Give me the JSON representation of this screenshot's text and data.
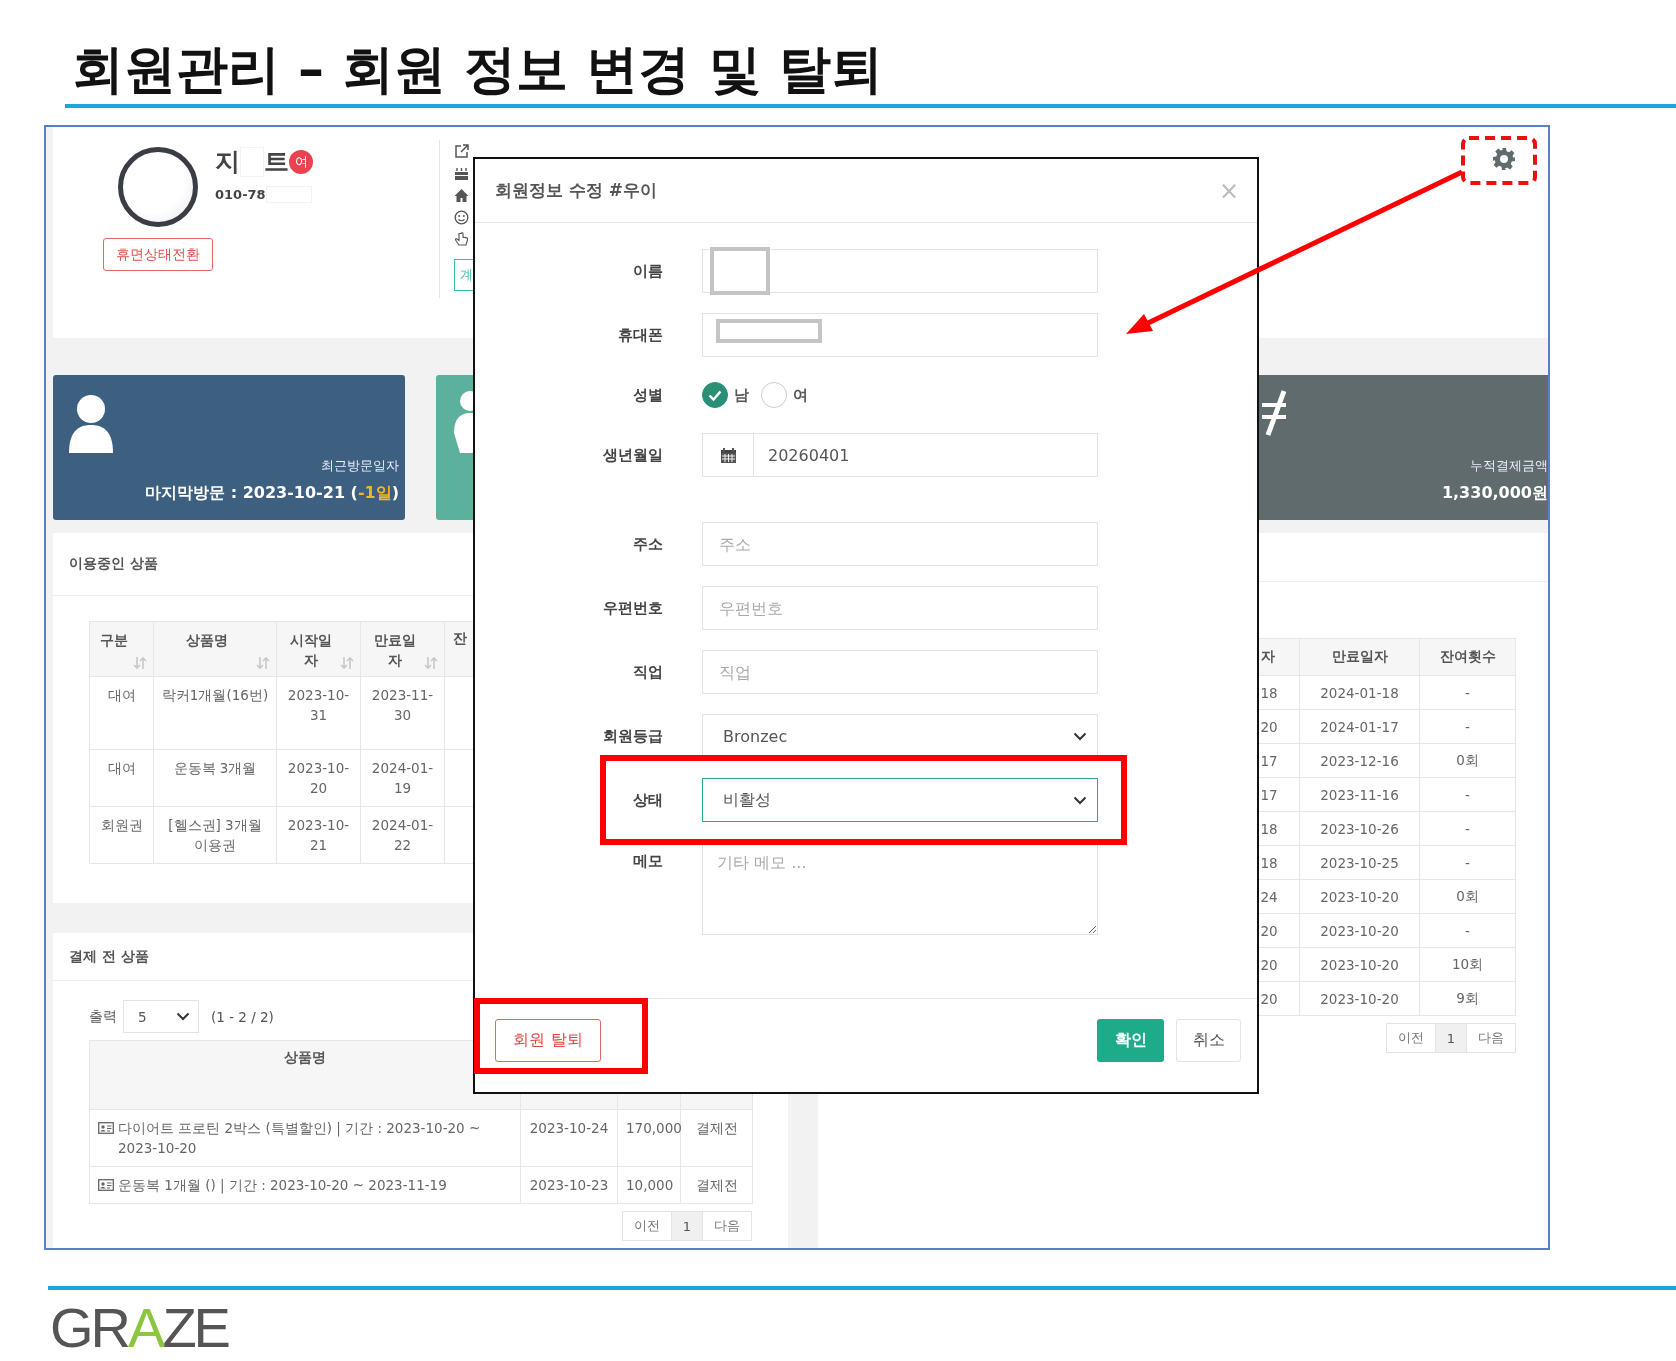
{
  "slide": {
    "title": "회원관리 – 회원 정보 변경 및 탈퇴",
    "logo": "GRAZE"
  },
  "profile": {
    "name_start": "지",
    "name_end": "트",
    "gender_badge": "여",
    "phone": "010-78",
    "dormant_button": "휴면상태전환",
    "side_button": "계"
  },
  "stats": [
    {
      "kind": "visit",
      "label": "최근방문일자",
      "prefix": "마지막방문 : 2023-10-21 (",
      "highlight": "-1일",
      "suffix": ")"
    },
    {
      "kind": "member"
    },
    {
      "kind": "payment",
      "label": "누적결제금액",
      "value": "1,330,000원"
    }
  ],
  "products_in_use": {
    "title": "이용중인 상품",
    "columns": [
      "구분",
      "상품명",
      "시작일자",
      "만료일자",
      "잔"
    ],
    "rows": [
      [
        "대여",
        "락커1개월(16번)",
        "2023-10-31",
        "2023-11-30"
      ],
      [
        "대여",
        "운동복 3개월",
        "2023-10-20",
        "2024-01-19"
      ],
      [
        "회원권",
        "[헬스권] 3개월 이용권",
        "2023-10-21",
        "2024-01-22"
      ]
    ]
  },
  "pending_products": {
    "title": "결제 전 상품",
    "page_size_label": "출력",
    "page_size": "5",
    "range": "(1 - 2 / 2)",
    "columns": [
      "상품명"
    ],
    "rows": [
      [
        "다이어트 프로틴 2박스 (특별할인) | 기간 : 2023-10-20 ~ 2023-10-20",
        "2023-10-24",
        "170,000",
        "결제전"
      ],
      [
        "운동복 1개월 () | 기간 : 2023-10-20 ~ 2023-11-19",
        "2023-10-23",
        "10,000",
        "결제전"
      ]
    ],
    "pagination": [
      {
        "label": "이전",
        "selected": false
      },
      {
        "label": "1",
        "selected": true
      },
      {
        "label": "다음",
        "selected": false
      }
    ]
  },
  "history": {
    "columns": [
      "자",
      "만료일자",
      "잔여횟수"
    ],
    "rows": [
      [
        "18",
        "2024-01-18",
        "-"
      ],
      [
        "20",
        "2024-01-17",
        "-"
      ],
      [
        "17",
        "2023-12-16",
        "0회"
      ],
      [
        "17",
        "2023-11-16",
        "-"
      ],
      [
        "18",
        "2023-10-26",
        "-"
      ],
      [
        "18",
        "2023-10-25",
        "-"
      ],
      [
        "24",
        "2023-10-20",
        "0회"
      ],
      [
        "20",
        "2023-10-20",
        "-"
      ],
      [
        "20",
        "2023-10-20",
        "10회"
      ],
      [
        "20",
        "2023-10-20",
        "9회"
      ]
    ],
    "pagination": [
      {
        "label": "이전",
        "selected": false
      },
      {
        "label": "1",
        "selected": true
      },
      {
        "label": "다음",
        "selected": false
      }
    ]
  },
  "modal": {
    "title": "회원정보 수정 #우이",
    "close": "×",
    "fields": [
      {
        "kind": "text",
        "label": "이름",
        "redacted": true
      },
      {
        "kind": "text",
        "label": "휴대폰",
        "redacted": true
      },
      {
        "kind": "radio",
        "label": "성별",
        "options": [
          {
            "label": "남",
            "selected": true
          },
          {
            "label": "여",
            "selected": false
          }
        ]
      },
      {
        "kind": "date",
        "label": "생년월일",
        "value": "20260401"
      },
      {
        "kind": "text",
        "label": "주소",
        "placeholder": "주소",
        "redacted": false
      },
      {
        "kind": "text",
        "label": "우편번호",
        "placeholder": "우편번호",
        "redacted": false
      },
      {
        "kind": "text",
        "label": "직업",
        "placeholder": "직업",
        "redacted": false
      },
      {
        "kind": "select",
        "label": "회원등급",
        "value": "Bronzec",
        "focused": false
      },
      {
        "kind": "select",
        "label": "상태",
        "value": "비활성",
        "focused": true
      },
      {
        "kind": "textarea",
        "label": "메모",
        "placeholder": "기타 메모 ..."
      }
    ],
    "withdraw": "회원 탈퇴",
    "confirm": "확인",
    "cancel": "취소"
  }
}
